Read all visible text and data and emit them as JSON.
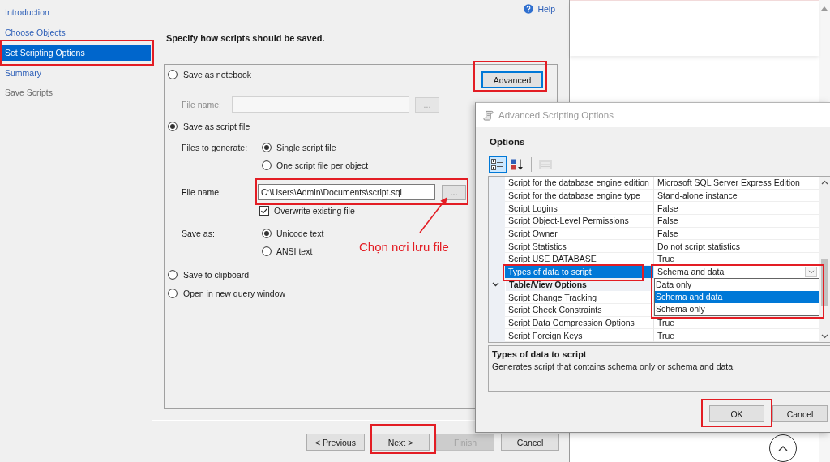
{
  "sidebar": {
    "items": [
      {
        "label": "Introduction",
        "selected": false,
        "disabled": false,
        "highlighted": false
      },
      {
        "label": "Choose Objects",
        "selected": false,
        "disabled": false,
        "highlighted": false
      },
      {
        "label": "Set Scripting Options",
        "selected": true,
        "disabled": false,
        "highlighted": true
      },
      {
        "label": "Summary",
        "selected": false,
        "disabled": false,
        "highlighted": false
      },
      {
        "label": "Save Scripts",
        "selected": false,
        "disabled": true,
        "highlighted": false
      }
    ]
  },
  "help_link": "Help",
  "heading": "Specify how scripts should be saved.",
  "advanced_button": {
    "label": "Advanced",
    "focused": true,
    "highlighted": true
  },
  "save_options": [
    {
      "label": "Save as notebook",
      "selected": false,
      "file_name": {
        "label": "File name:",
        "disabled": true,
        "browse": "...",
        "highlighted": false
      }
    },
    {
      "label": "Save as script file",
      "selected": true,
      "files_to_generate": {
        "label": "Files to generate:",
        "choices": [
          {
            "label": "Single script file",
            "selected": true
          },
          {
            "label": "One script file per object",
            "selected": false
          }
        ]
      },
      "file_name": {
        "label": "File name:",
        "value": "C:\\Users\\Admin\\Documents\\script.sql",
        "disabled": false,
        "browse": "...",
        "highlighted": true
      },
      "overwrite": {
        "label": "Overwrite existing file",
        "checked": true
      },
      "save_as": {
        "label": "Save as:",
        "choices": [
          {
            "label": "Unicode text",
            "selected": true
          },
          {
            "label": "ANSI text",
            "selected": false
          }
        ]
      }
    },
    {
      "label": "Save to clipboard",
      "selected": false
    },
    {
      "label": "Open in new query window",
      "selected": false
    }
  ],
  "callout": {
    "text": "Chọn nơi lưu file"
  },
  "nav_buttons": [
    {
      "label": "< Previous",
      "disabled": false,
      "highlighted": false
    },
    {
      "label": "Next >",
      "disabled": false,
      "highlighted": true
    },
    {
      "label": "Finish",
      "disabled": true,
      "highlighted": false
    },
    {
      "label": "Cancel",
      "disabled": false,
      "highlighted": false
    }
  ],
  "advanced_dialog": {
    "title": "Advanced Scripting Options",
    "section": "Options",
    "toolbar": [
      {
        "kind": "categorized",
        "selected": true,
        "disabled": false
      },
      {
        "kind": "alphabetical",
        "selected": false,
        "disabled": false
      },
      {
        "kind": "property_pages",
        "selected": false,
        "disabled": true
      }
    ],
    "rows": [
      {
        "kind": "property",
        "name": "Script for the database engine edition",
        "value": "Microsoft SQL Server Express Edition",
        "selected": false,
        "highlighted": false
      },
      {
        "kind": "property",
        "name": "Script for the database engine type",
        "value": "Stand-alone instance",
        "selected": false,
        "highlighted": false
      },
      {
        "kind": "property",
        "name": "Script Logins",
        "value": "False",
        "selected": false,
        "highlighted": false
      },
      {
        "kind": "property",
        "name": "Script Object-Level Permissions",
        "value": "False",
        "selected": false,
        "highlighted": false
      },
      {
        "kind": "property",
        "name": "Script Owner",
        "value": "False",
        "selected": false,
        "highlighted": false
      },
      {
        "kind": "property",
        "name": "Script Statistics",
        "value": "Do not script statistics",
        "selected": false,
        "highlighted": false
      },
      {
        "kind": "property",
        "name": "Script USE DATABASE",
        "value": "True",
        "selected": false,
        "highlighted": false
      },
      {
        "kind": "property",
        "name": "Types of data to script",
        "value": "Schema and data",
        "selected": true,
        "highlighted": true,
        "dropdown": {
          "expanded": true,
          "highlighted": true,
          "options": [
            {
              "label": "Data only",
              "selected": false
            },
            {
              "label": "Schema and data",
              "selected": true
            },
            {
              "label": "Schema only",
              "selected": false
            }
          ]
        }
      },
      {
        "kind": "category",
        "name": "Table/View Options",
        "expanded": true,
        "selected": false
      },
      {
        "kind": "property",
        "name": "Script Change Tracking",
        "selected": false,
        "highlighted": false
      },
      {
        "kind": "property",
        "name": "Script Check Constraints",
        "selected": false,
        "highlighted": false
      },
      {
        "kind": "property",
        "name": "Script Data Compression Options",
        "value": "True",
        "selected": false,
        "highlighted": false
      },
      {
        "kind": "property",
        "name": "Script Foreign Keys",
        "value": "True",
        "selected": false,
        "highlighted": false
      }
    ],
    "description": {
      "title": "Types of data to script",
      "text": "Generates script that contains schema only or schema and data."
    },
    "buttons": [
      {
        "label": "OK",
        "highlighted": true
      },
      {
        "label": "Cancel",
        "highlighted": false
      }
    ]
  }
}
